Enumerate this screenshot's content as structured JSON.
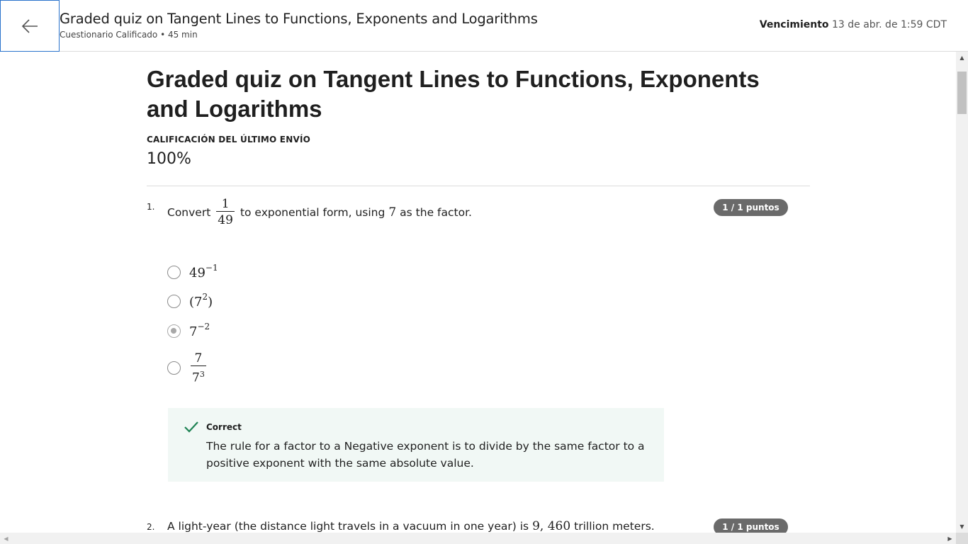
{
  "header": {
    "title": "Graded quiz on Tangent Lines to Functions, Exponents and Logarithms",
    "subtitle": "Cuestionario Calificado • 45 min",
    "due_label": "Vencimiento",
    "due_value": "13 de abr. de 1:59 CDT"
  },
  "quiz": {
    "title": "Graded quiz on Tangent Lines to Functions, Exponents and Logarithms",
    "grade_label": "CALIFICACIÓN DEL ÚLTIMO ENVÍO",
    "grade_value": "100%"
  },
  "questions": [
    {
      "number": "1.",
      "text_before": "Convert",
      "frac_num": "1",
      "frac_den": "49",
      "text_middle": "to exponential form, using",
      "factor": "7",
      "text_after": "as the factor.",
      "points": "1 / 1 puntos",
      "options": [
        {
          "base": "49",
          "exp": "−1",
          "selected": false
        },
        {
          "base": "(7",
          "exp": "2",
          "suffix": ")",
          "selected": false
        },
        {
          "base": "7",
          "exp": "−2",
          "selected": true
        },
        {
          "frac_num": "7",
          "frac_den_base": "7",
          "frac_den_exp": "3",
          "selected": false
        }
      ],
      "feedback": {
        "title": "Correct",
        "text": "The rule for a factor to a Negative exponent is to divide by the same factor to a positive exponent with the same absolute value."
      }
    },
    {
      "number": "2.",
      "text_before": "A light-year (the distance light travels in a vacuum in one year) is",
      "value": "9, 460",
      "text_after": "trillion meters.",
      "points": "1 / 1 puntos"
    }
  ],
  "icons": {
    "back": "arrow-left-icon",
    "check": "checkmark-icon"
  },
  "colors": {
    "focus_border": "#2a73cc",
    "badge": "#6a6a6a",
    "feedback_bg": "#f1f8f5",
    "check": "#1f8354"
  }
}
